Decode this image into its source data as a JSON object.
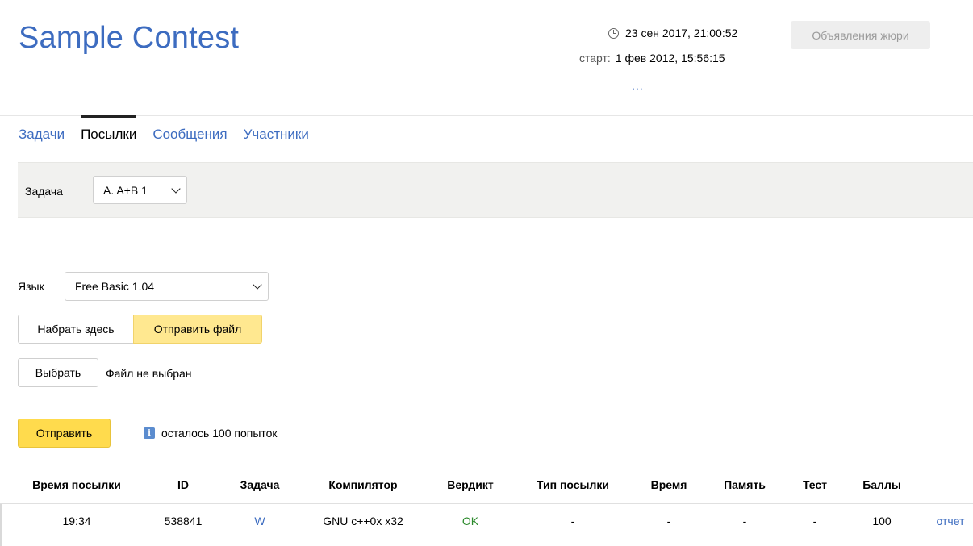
{
  "header": {
    "title": "Sample Contest",
    "current_time": "23 сен 2017, 21:00:52",
    "start_label": "старт:",
    "start_time": "1 фев 2012, 15:56:15",
    "more": "...",
    "jury_button": "Объявления жюри"
  },
  "tabs": [
    {
      "label": "Задачи",
      "active": false
    },
    {
      "label": "Посылки",
      "active": true
    },
    {
      "label": "Сообщения",
      "active": false
    },
    {
      "label": "Участники",
      "active": false
    }
  ],
  "filter": {
    "label": "Задача",
    "selected": "A. A+B 1"
  },
  "submit_form": {
    "language_label": "Язык",
    "language_selected": "Free Basic 1.04",
    "type_here_button": "Набрать здесь",
    "send_file_button": "Отправить файл",
    "choose_button": "Выбрать",
    "file_status": "Файл не выбран",
    "submit_button": "Отправить",
    "attempts_text": "осталось 100 попыток"
  },
  "table": {
    "columns": [
      "Время посылки",
      "ID",
      "Задача",
      "Компилятор",
      "Вердикт",
      "Тип посылки",
      "Время",
      "Память",
      "Тест",
      "Баллы"
    ],
    "rows": [
      {
        "time": "19:34",
        "id": "538841",
        "problem": "W",
        "compiler": "GNU c++0x x32",
        "verdict": "OK",
        "type": "-",
        "run_time": "-",
        "memory": "-",
        "test": "-",
        "score": "100",
        "report": "отчет"
      }
    ]
  },
  "colors": {
    "accent": "#3d6cc0",
    "primary_button": "#ffdb4d",
    "ok": "#2c8a2c"
  }
}
